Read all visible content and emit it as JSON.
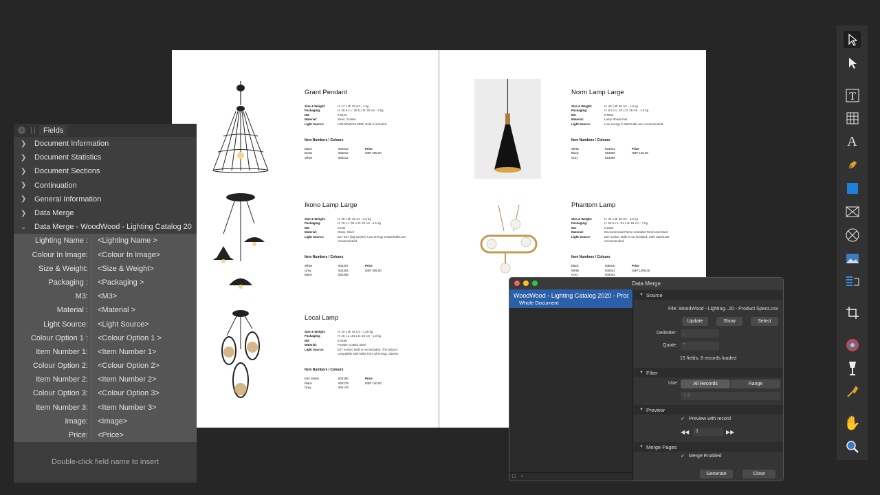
{
  "catalog": {
    "products": [
      {
        "name": "Grant Pendant",
        "specs": [
          [
            "Size & Weight:",
            "H: 17 x Ø: 23 cm - 1 kg"
          ],
          [
            "Packaging:",
            "H: 26.5 x L: 26.5 x D: 20 cm - 2 kg"
          ],
          [
            "M3:",
            "0.0162"
          ],
          [
            "Material:",
            "Steel, Granite"
          ],
          [
            "Light Source:",
            "LED 5kWh/10,000h. Bulb is included."
          ]
        ],
        "items_heading": "Item Numbers / Colours",
        "colours": [
          "Black",
          "Brass",
          "White"
        ],
        "numbers": [
          "502013",
          "502012",
          "502011"
        ],
        "price_label": "Price",
        "price": "GBP 485.00"
      },
      {
        "name": "Ikono Lamp Large",
        "specs": [
          [
            "Size & Weight:",
            "H: 30 x Ø: 45 cm - 3.5 kg"
          ],
          [
            "Packaging:",
            "H: 79 x L: 51 x D: 26 cm - 5.1 kg"
          ],
          [
            "M3:",
            "0.108"
          ],
          [
            "Material:",
            "Glass, Steel"
          ],
          [
            "Light Source:",
            "E27 E27 (big socket). Low-energy 9 Watt bulbs are recommended."
          ]
        ],
        "items_heading": "Item Numbers / Colours",
        "colours": [
          "White",
          "Grey",
          "Black"
        ],
        "numbers": [
          "502307",
          "502304",
          "502305"
        ],
        "price_label": "Price",
        "price": "GBP 305.00"
      },
      {
        "name": "Local Lamp",
        "specs": [
          [
            "Size & Weight:",
            "H: 19 x Ø: 28 cm - 1.25 kg"
          ],
          [
            "Packaging:",
            "H: 25 x L: 34 x D: 34 cm - 1.9 kg"
          ],
          [
            "M3:",
            "0.0188"
          ],
          [
            "Material:",
            "Powder Coated Steel"
          ],
          [
            "Light Source:",
            "E27 socket. Bulb is not included. The lamp is compatible with bulbs from all energy classes."
          ]
        ],
        "items_heading": "Item Numbers / Colours",
        "colours": [
          "Elm Green",
          "Black",
          "Grey"
        ],
        "numbers": [
          "502180",
          "502179",
          "502178"
        ],
        "price_label": "Price",
        "price": "GBP 120.00"
      },
      {
        "name": "Norm Lamp Large",
        "specs": [
          [
            "Size & Weight:",
            "H: 40 x Ø: 65 cm - 1.6 kg"
          ],
          [
            "Packaging:",
            "H: 6.5 x L: 40 x D: 28 cm - 1.9 kg"
          ],
          [
            "M3:",
            "0.0504"
          ],
          [
            "Material:",
            "Lamp Shade Foil"
          ],
          [
            "Light Source:",
            "Low-energy 9 Watt bulbs are recommended."
          ]
        ],
        "items_heading": "Item Numbers / Colours",
        "colours": [
          "White",
          "Black",
          "Grey"
        ],
        "numbers": [
          "554001",
          "554000",
          "554099"
        ],
        "price_label": "Price",
        "price": "GBP 125.00"
      },
      {
        "name": "Phantom Lamp",
        "specs": [
          [
            "Size & Weight:",
            "H: 44 x Ø: 80 cm - 4.2 kg"
          ],
          [
            "Packaging:",
            "H: 52.6 x L: 91 x D: 91 cm - 7 kg"
          ],
          [
            "M3:",
            "0.0342"
          ],
          [
            "Material:",
            "Environmental Flame-retardant Resin and Steel"
          ],
          [
            "Light Source:",
            "E27 socket. Bulb is not included. 13W LED/5120 recommended."
          ]
        ],
        "items_heading": "Item Numbers / Colours",
        "colours": [
          "Black",
          "White",
          "Grey"
        ],
        "numbers": [
          "505040",
          "505041",
          "505042"
        ],
        "price_label": "Price",
        "price": "GBP 1090.00"
      }
    ]
  },
  "fields_panel": {
    "tab": "Fields",
    "close_glyph": "×",
    "sections": [
      "Document Information",
      "Document Statistics",
      "Document Sections",
      "Continuation",
      "General Information",
      "Data Merge",
      "Data Merge - WoodWood - Lighting Catalog 20"
    ],
    "rows": [
      {
        "name": "Lighting Name :",
        "value": "<Lighting Name >"
      },
      {
        "name": "Colour In Image:",
        "value": "<Colour In Image>"
      },
      {
        "name": "Size & Weight:",
        "value": "<Size & Weight>"
      },
      {
        "name": "Packaging :",
        "value": "<Packaging >"
      },
      {
        "name": "M3:",
        "value": "<M3>"
      },
      {
        "name": "Material :",
        "value": "<Material >"
      },
      {
        "name": "Light Source:",
        "value": "<Light Source>"
      },
      {
        "name": "Colour Option 1 :",
        "value": "<Colour Option 1 >"
      },
      {
        "name": "Item Number 1:",
        "value": "<Item Number 1>"
      },
      {
        "name": "Colour Option 2:",
        "value": "<Colour Option 2>"
      },
      {
        "name": "Item Number 2:",
        "value": "<Item Number 2>"
      },
      {
        "name": "Colour Option 3:",
        "value": "<Colour Option 3>"
      },
      {
        "name": "Item Number 3:",
        "value": "<Item Number 3>"
      },
      {
        "name": "Image:",
        "value": "<Image>"
      },
      {
        "name": "Price:",
        "value": "<Price>"
      }
    ],
    "hint": "Double-click field name to insert"
  },
  "data_merge": {
    "title": "Data Merge",
    "source_name": "WoodWood - Lighting Catalog 2020 - Prod",
    "source_sub": "Whole Document",
    "source_header": "Source",
    "file_label": "File:",
    "file_value": "WoodWood - Lighting...20 - Product Specs.csv",
    "update": "Update",
    "show": "Show",
    "select": "Select",
    "delimiter_label": "Delimiter:",
    "delimiter_value": ",",
    "quote_label": "Quote:",
    "quote_value": "\"",
    "records_info": "15 fields, 8 records loaded",
    "filter_header": "Filter",
    "use_label": "Use:",
    "all_records": "All Records",
    "range": "Range",
    "range_value": "1-8",
    "preview_header": "Preview",
    "preview_with_record": "Preview with record",
    "record_number": "1",
    "merge_pages_header": "Merge Pages",
    "merge_enabled": "Merge Enabled",
    "generate": "Generate",
    "close": "Close"
  },
  "toolbar": {
    "tools": [
      "move-tool-icon",
      "node-tool-icon",
      "frame-text-tool-icon",
      "table-tool-icon",
      "artistic-text-tool-icon",
      "pen-tool-icon",
      "rectangle-tool-icon",
      "picture-frame-tool-icon",
      "ellipse-frame-tool-icon",
      "place-image-tool-icon",
      "vector-crop-tool-icon",
      "crop-tool-icon",
      "color-picker-icon",
      "fill-tool-icon",
      "transparency-tool-icon",
      "hand-tool-icon",
      "zoom-tool-icon"
    ],
    "text_glyph": "A"
  },
  "colors": {
    "accent": "#2b5fa8",
    "close_red": "#fe5f57",
    "min_yellow": "#febc2e",
    "max_green": "#28c840"
  }
}
